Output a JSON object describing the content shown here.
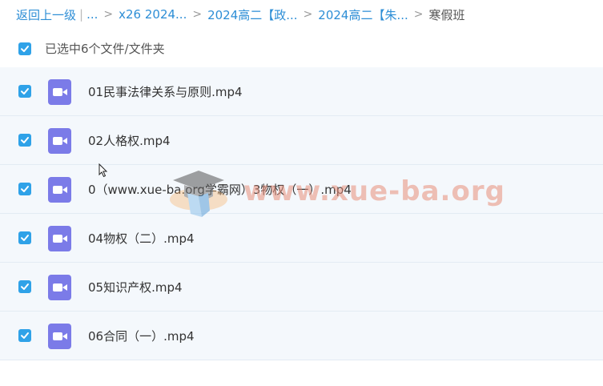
{
  "breadcrumb": {
    "back": "返回上一级",
    "divider": "|",
    "ellipsis": "...",
    "sep": ">",
    "items": [
      "x26 2024...",
      "2024高二【政...",
      "2024高二【朱..."
    ],
    "current": "寒假班"
  },
  "selection": {
    "text": "已选中6个文件/文件夹",
    "checked": true
  },
  "files": [
    {
      "name": "01民事法律关系与原则.mp4",
      "checked": true,
      "icon": "video-file-icon"
    },
    {
      "name": "02人格权.mp4",
      "checked": true,
      "icon": "video-file-icon"
    },
    {
      "name": "0（www.xue-ba.org学霸网）3物权（一）.mp4",
      "checked": true,
      "icon": "video-file-icon"
    },
    {
      "name": "04物权（二）.mp4",
      "checked": true,
      "icon": "video-file-icon"
    },
    {
      "name": "05知识产权.mp4",
      "checked": true,
      "icon": "video-file-icon"
    },
    {
      "name": "06合同（一）.mp4",
      "checked": true,
      "icon": "video-file-icon"
    }
  ],
  "watermark": {
    "text": "www.xue-ba.org"
  },
  "colors": {
    "link": "#2d8ed6",
    "checkbox": "#2fa2e8",
    "video_icon": "#7b7be8",
    "row_bg": "#f4f8fc",
    "watermark": "#e88f7a"
  }
}
